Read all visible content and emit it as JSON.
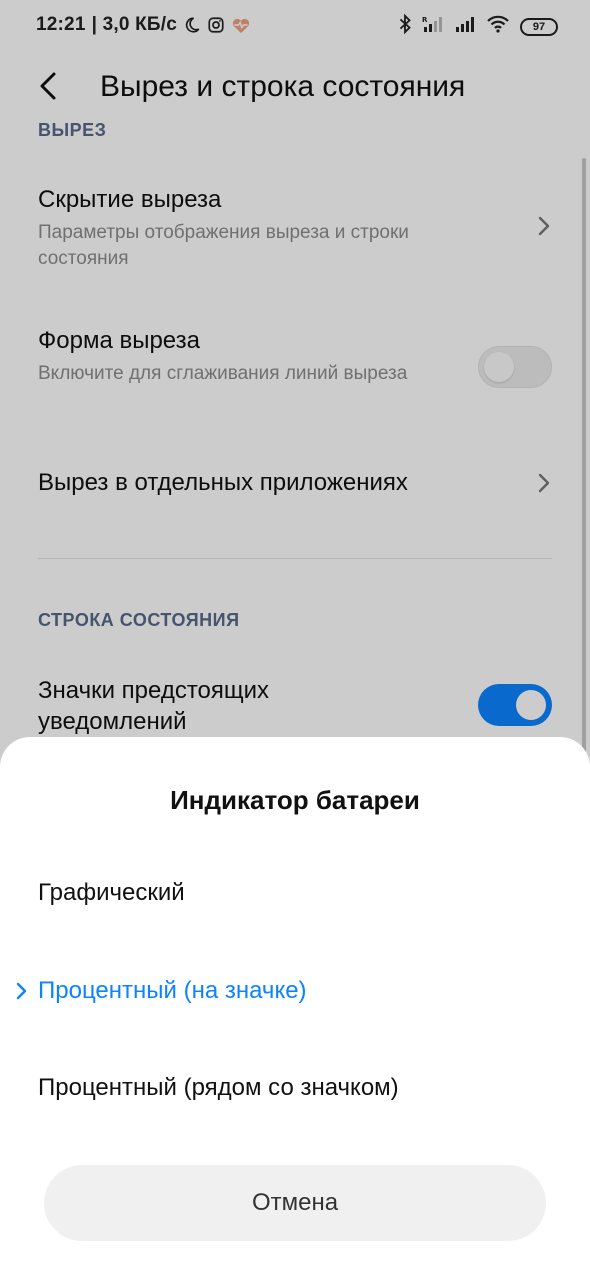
{
  "status_bar": {
    "time": "12:21",
    "network_speed": "| 3,0 КБ/с",
    "battery_level": "97",
    "icons": [
      "moon-icon",
      "instagram-icon",
      "heart-rate-icon",
      "bluetooth-icon",
      "signal-r-icon",
      "signal-icon",
      "wifi-icon",
      "battery-icon"
    ]
  },
  "header": {
    "title": "Вырез и строка состояния",
    "back_icon": "back-arrow-icon"
  },
  "settings": {
    "section_notch": "ВЫРЕЗ",
    "notch_hide": {
      "title": "Скрытие выреза",
      "subtitle": "Параметры отображения выреза и строки состояния"
    },
    "notch_shape": {
      "title": "Форма выреза",
      "subtitle": "Включите для сглаживания линий выреза",
      "enabled": false
    },
    "notch_apps": {
      "title": "Вырез в отдельных приложениях"
    },
    "section_status_bar": "СТРОКА СОСТОЯНИЯ",
    "upcoming_notifications": {
      "title": "Значки предстоящих уведомлений",
      "enabled": true
    }
  },
  "sheet": {
    "title": "Индикатор батареи",
    "options": [
      {
        "label": "Графический",
        "selected": false
      },
      {
        "label": "Процентный (на значке)",
        "selected": true
      },
      {
        "label": "Процентный (рядом со значком)",
        "selected": false
      }
    ],
    "cancel_label": "Отмена"
  },
  "colors": {
    "accent": "#0d84ff",
    "section_label": "#5a6a8a",
    "subtitle": "#8c8c8c"
  }
}
